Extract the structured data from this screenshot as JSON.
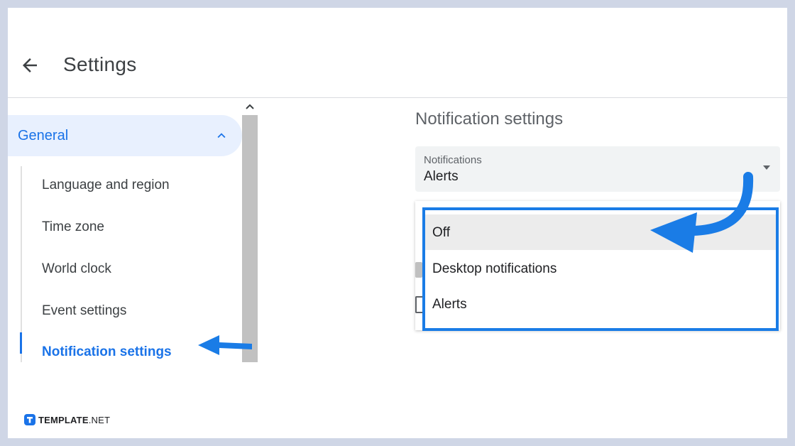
{
  "header": {
    "title": "Settings",
    "back_icon": "arrow-left-icon"
  },
  "sidebar": {
    "section": {
      "label": "General",
      "expanded": true,
      "chevron_icon": "chevron-up-icon"
    },
    "items": [
      {
        "label": "Language and region",
        "active": false
      },
      {
        "label": "Time zone",
        "active": false
      },
      {
        "label": "World clock",
        "active": false
      },
      {
        "label": "Event settings",
        "active": false
      },
      {
        "label": "Notification settings",
        "active": true
      }
    ]
  },
  "main": {
    "heading": "Notification settings",
    "select": {
      "label": "Notifications",
      "value": "Alerts"
    },
    "dropdown_options": [
      {
        "label": "Off",
        "highlighted": true
      },
      {
        "label": "Desktop notifications",
        "highlighted": false
      },
      {
        "label": "Alerts",
        "highlighted": false
      }
    ]
  },
  "watermark": {
    "brand": "TEMPLATE",
    "suffix": ".NET"
  },
  "colors": {
    "accent": "#1a73e8",
    "annotation": "#1a7ce6",
    "active_bg": "#e8f0fe"
  }
}
